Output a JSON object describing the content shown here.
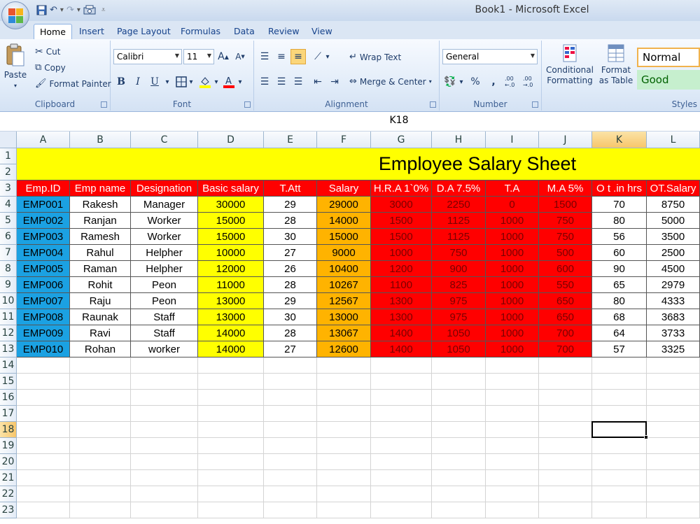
{
  "window": {
    "title": "Book1 - Microsoft Excel"
  },
  "qat": {
    "save_icon": "save-icon",
    "undo_icon": "undo-icon",
    "redo_icon": "redo-icon",
    "print_icon": "print-preview-icon",
    "customize_icon": "customize-qat-icon"
  },
  "tabs": [
    {
      "label": "Home"
    },
    {
      "label": "Insert"
    },
    {
      "label": "Page Layout"
    },
    {
      "label": "Formulas"
    },
    {
      "label": "Data"
    },
    {
      "label": "Review"
    },
    {
      "label": "View"
    }
  ],
  "ribbon": {
    "clipboard": {
      "label": "Clipboard",
      "paste": "Paste",
      "cut": "Cut",
      "copy": "Copy",
      "format_painter": "Format Painter"
    },
    "font": {
      "label": "Font",
      "name": "Calibri",
      "size": "11",
      "bold": "B",
      "italic": "I",
      "underline": "U"
    },
    "alignment": {
      "label": "Alignment",
      "wrap_text": "Wrap Text",
      "merge_center": "Merge & Center"
    },
    "number": {
      "label": "Number",
      "format": "General",
      "percent": "%",
      "comma": ",",
      "inc_decimal": ".00 ←.0",
      "dec_decimal": ".00 →.0"
    },
    "styles": {
      "label": "Styles",
      "conditional_1": "Conditional",
      "conditional_2": "Formatting",
      "format_table_1": "Format",
      "format_table_2": "as Table",
      "normal": "Normal",
      "good": "Good"
    }
  },
  "formula_bar": {
    "name_box": "K18"
  },
  "colors": {
    "header_red": "#ff0000",
    "title_yellow": "#ffff00",
    "id_blue": "#1ba1e2",
    "basic_yellow": "#ffff00",
    "salary_orange": "#ffb300",
    "good_green": "#c6efce"
  },
  "sheet": {
    "columns": [
      "A",
      "B",
      "C",
      "D",
      "E",
      "F",
      "G",
      "H",
      "I",
      "J",
      "K",
      "L"
    ],
    "rows": [
      "1",
      "2",
      "3",
      "4",
      "5",
      "6",
      "7",
      "8",
      "9",
      "10",
      "11",
      "12",
      "13",
      "14",
      "15",
      "16",
      "17",
      "18",
      "19",
      "20",
      "21",
      "22",
      "23"
    ],
    "selected_column": "K",
    "selected_row": "18",
    "title": "Employee Salary Sheet",
    "headers": [
      "Emp.ID",
      "Emp name",
      "Designation",
      "Basic salary",
      "T.Att",
      "Salary",
      "H.R.A 1`0%",
      "D.A 7.5%",
      "T.A",
      "M.A 5%",
      "O t .in hrs",
      "OT.Salary"
    ],
    "records": [
      [
        "EMP001",
        "Rakesh",
        "Manager",
        "30000",
        "29",
        "29000",
        "3000",
        "2250",
        "0",
        "1500",
        "70",
        "8750"
      ],
      [
        "EMP002",
        "Ranjan",
        "Worker",
        "15000",
        "28",
        "14000",
        "1500",
        "1125",
        "1000",
        "750",
        "80",
        "5000"
      ],
      [
        "EMP003",
        "Ramesh",
        "Worker",
        "15000",
        "30",
        "15000",
        "1500",
        "1125",
        "1000",
        "750",
        "56",
        "3500"
      ],
      [
        "EMP004",
        "Rahul",
        "Helpher",
        "10000",
        "27",
        "9000",
        "1000",
        "750",
        "1000",
        "500",
        "60",
        "2500"
      ],
      [
        "EMP005",
        "Raman",
        "Helpher",
        "12000",
        "26",
        "10400",
        "1200",
        "900",
        "1000",
        "600",
        "90",
        "4500"
      ],
      [
        "EMP006",
        "Rohit",
        "Peon",
        "11000",
        "28",
        "10267",
        "1100",
        "825",
        "1000",
        "550",
        "65",
        "2979"
      ],
      [
        "EMP007",
        "Raju",
        "Peon",
        "13000",
        "29",
        "12567",
        "1300",
        "975",
        "1000",
        "650",
        "80",
        "4333"
      ],
      [
        "EMP008",
        "Raunak",
        "Staff",
        "13000",
        "30",
        "13000",
        "1300",
        "975",
        "1000",
        "650",
        "68",
        "3683"
      ],
      [
        "EMP009",
        "Ravi",
        "Staff",
        "14000",
        "28",
        "13067",
        "1400",
        "1050",
        "1000",
        "700",
        "64",
        "3733"
      ],
      [
        "EMP010",
        "Rohan",
        "worker",
        "14000",
        "27",
        "12600",
        "1400",
        "1050",
        "1000",
        "700",
        "57",
        "3325"
      ]
    ]
  }
}
